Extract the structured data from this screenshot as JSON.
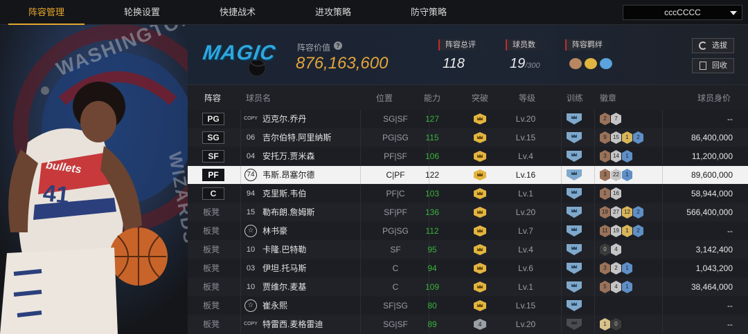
{
  "nav": {
    "tabs": [
      "阵容管理",
      "轮换设置",
      "快捷战术",
      "进攻策略",
      "防守策略"
    ],
    "active_tab": 0,
    "team_selector": "cccCCCC"
  },
  "left_panel": {
    "bg_text": "WASHINGTON",
    "bg_text2": "WIZARDS",
    "jersey_team": "bullets",
    "jersey_number": "41"
  },
  "header": {
    "logo_text": "MAGIC",
    "roster_value_label": "阵容价值",
    "roster_value": "876,163,600",
    "overall_label": "阵容总评",
    "overall_value": "118",
    "players_label": "球员数",
    "players_value": "19",
    "players_max": "/300",
    "bonds_label": "阵容羁绊",
    "select_button": "选拔",
    "recycle_button": "回收"
  },
  "table": {
    "headers": [
      "阵容",
      "球员名",
      "位置",
      "能力",
      "突破",
      "等级",
      "训练",
      "徽章",
      "球员身价"
    ],
    "rows": [
      {
        "slot": "PG",
        "starter": true,
        "num": "COPY",
        "num_type": "copy",
        "name": "迈克尔.乔丹",
        "pos": "SG|SF",
        "ability": "127",
        "break": "crown",
        "level": "Lv.20",
        "train": "blue",
        "badges": [
          [
            "bronze",
            "2"
          ],
          [
            "silver",
            "7"
          ]
        ],
        "value": "--"
      },
      {
        "slot": "SG",
        "starter": true,
        "num": "06",
        "num_type": "plain",
        "name": "吉尔伯特.阿里纳斯",
        "pos": "PG|SG",
        "ability": "115",
        "break": "crown",
        "level": "Lv.15",
        "train": "blue",
        "badges": [
          [
            "bronze",
            "9"
          ],
          [
            "silver",
            "15"
          ],
          [
            "gold",
            "1"
          ],
          [
            "blue",
            "2"
          ]
        ],
        "value": "86,400,000"
      },
      {
        "slot": "SF",
        "starter": true,
        "num": "04",
        "num_type": "plain",
        "name": "安托万.贾米森",
        "pos": "PF|SF",
        "ability": "106",
        "break": "crown",
        "level": "Lv.4",
        "train": "blue",
        "badges": [
          [
            "bronze",
            "3"
          ],
          [
            "silver",
            "14"
          ],
          [
            "blue",
            "1"
          ]
        ],
        "value": "11,200,000"
      },
      {
        "slot": "PF",
        "starter": true,
        "num": "74",
        "num_type": "circle",
        "name": "韦斯.昂塞尔德",
        "pos": "C|PF",
        "ability": "122",
        "break": "crown",
        "level": "Lv.16",
        "train": "blue",
        "badges": [
          [
            "bronze",
            "3"
          ],
          [
            "silver",
            "22"
          ],
          [
            "blue",
            "1"
          ]
        ],
        "value": "89,600,000",
        "selected": true
      },
      {
        "slot": "C",
        "starter": true,
        "num": "94",
        "num_type": "plain",
        "name": "克里斯.韦伯",
        "pos": "PF|C",
        "ability": "103",
        "break": "crown",
        "level": "Lv.1",
        "train": "blue",
        "badges": [
          [
            "bronze",
            "1"
          ],
          [
            "silver",
            "16"
          ]
        ],
        "value": "58,944,000"
      },
      {
        "slot": "板凳",
        "starter": false,
        "num": "15",
        "num_type": "plain",
        "name": "勒布朗.詹姆斯",
        "pos": "SF|PF",
        "ability": "136",
        "break": "crown",
        "level": "Lv.20",
        "train": "blue",
        "badges": [
          [
            "bronze",
            "19"
          ],
          [
            "silver",
            "27"
          ],
          [
            "gold",
            "12"
          ],
          [
            "blue",
            "2"
          ]
        ],
        "value": "566,400,000"
      },
      {
        "slot": "板凳",
        "starter": false,
        "num": "☆",
        "num_type": "circle",
        "name": "林书豪",
        "pos": "PG|SG",
        "ability": "112",
        "break": "crown",
        "level": "Lv.7",
        "train": "blue",
        "badges": [
          [
            "bronze",
            "11"
          ],
          [
            "silver",
            "19"
          ],
          [
            "gold",
            "1"
          ],
          [
            "blue",
            "2"
          ]
        ],
        "value": "--"
      },
      {
        "slot": "板凳",
        "starter": false,
        "num": "10",
        "num_type": "plain",
        "name": "卡隆.巴特勒",
        "pos": "SF",
        "ability": "95",
        "break": "crown",
        "level": "Lv.4",
        "train": "blue",
        "badges": [
          [
            "dark",
            "0"
          ],
          [
            "silver",
            "4"
          ]
        ],
        "value": "3,142,400"
      },
      {
        "slot": "板凳",
        "starter": false,
        "num": "03",
        "num_type": "plain",
        "name": "伊坦.托马斯",
        "pos": "C",
        "ability": "94",
        "break": "crown",
        "level": "Lv.6",
        "train": "blue",
        "badges": [
          [
            "bronze",
            "3"
          ],
          [
            "silver",
            "2"
          ],
          [
            "blue",
            "1"
          ]
        ],
        "value": "1,043,200"
      },
      {
        "slot": "板凳",
        "starter": false,
        "num": "10",
        "num_type": "plain",
        "name": "贾维尔.麦基",
        "pos": "C",
        "ability": "109",
        "break": "crown",
        "level": "Lv.1",
        "train": "blue",
        "badges": [
          [
            "bronze",
            "5"
          ],
          [
            "silver",
            "4"
          ],
          [
            "blue",
            "1"
          ]
        ],
        "value": "38,464,000"
      },
      {
        "slot": "板凳",
        "starter": false,
        "num": "☆",
        "num_type": "circle",
        "name": "崔永熙",
        "pos": "SF|SG",
        "ability": "80",
        "break": "crown",
        "level": "Lv.15",
        "train": "blue",
        "badges": [],
        "value": "--"
      },
      {
        "slot": "板凳",
        "starter": false,
        "num": "COPY",
        "num_type": "copy",
        "name": "特雷西.麦格雷迪",
        "pos": "SG|SF",
        "ability": "89",
        "break": "4",
        "level": "Lv.20",
        "train": "dark",
        "badges": [
          [
            "lightgold",
            "1"
          ],
          [
            "dark",
            "0"
          ]
        ],
        "value": "--"
      }
    ]
  }
}
